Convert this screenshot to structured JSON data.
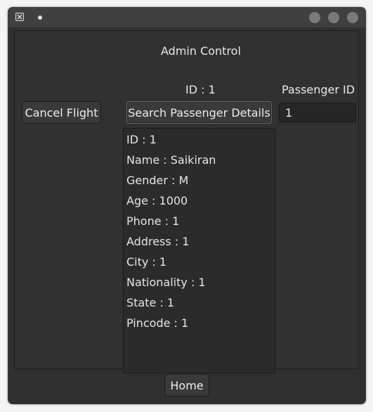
{
  "window": {
    "title": ""
  },
  "header": {
    "title": "Admin Control"
  },
  "search": {
    "id_label": "ID : 1",
    "passenger_id_label": "Passenger ID",
    "passenger_id_value": "1",
    "search_button_label": "Search Passenger Details"
  },
  "actions": {
    "cancel_label": "Cancel Flight",
    "home_label": "Home"
  },
  "details": {
    "rows": [
      "ID : 1",
      "Name : Saikiran",
      "Gender : M",
      "Age : 1000",
      "Phone : 1",
      "Address : 1",
      "City : 1",
      "Nationality : 1",
      "State : 1",
      "Pincode : 1"
    ]
  },
  "icons": {
    "app": "app-x-icon",
    "dot": "window-menu-dot-icon",
    "minimize": "minimize-button",
    "maximize": "maximize-button",
    "close": "close-button"
  }
}
